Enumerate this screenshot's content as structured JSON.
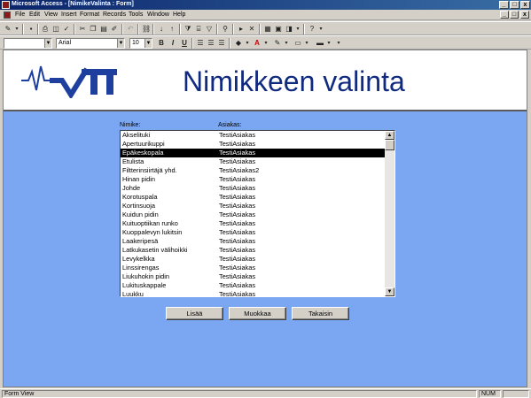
{
  "window": {
    "title": "Microsoft Access - [NimikeValinta : Form]",
    "min": "_",
    "max": "□",
    "close": "x"
  },
  "menu": [
    "File",
    "Edit",
    "View",
    "Insert",
    "Format",
    "Records",
    "Tools",
    "Window",
    "Help"
  ],
  "mdi": {
    "min": "_",
    "max": "□",
    "close": "x"
  },
  "toolbar_format": {
    "object_combo": "",
    "font_combo": "Arial",
    "size_combo": "10",
    "bold": "B",
    "italic": "I",
    "underline": "U"
  },
  "form": {
    "title": "Nimikkeen valinta",
    "col_headers": [
      "Nimike:",
      "Asiakas:"
    ],
    "rows": [
      [
        "Akselituki",
        "TestiAsiakas"
      ],
      [
        "Apertuurikuppi",
        "TestiAsiakas"
      ],
      [
        "Epäkeskopala",
        "TestiAsiakas"
      ],
      [
        "Etulista",
        "TestiAsiakas"
      ],
      [
        "Filtterinsiirtäjä yhd.",
        "TestiAsiakas2"
      ],
      [
        "Hinan pidin",
        "TestiAsiakas"
      ],
      [
        "Johde",
        "TestiAsiakas"
      ],
      [
        "Korotuspala",
        "TestiAsiakas"
      ],
      [
        "Kortinsuoja",
        "TestiAsiakas"
      ],
      [
        "Kuidun pidin",
        "TestiAsiakas"
      ],
      [
        "Kuituoptiikan runko",
        "TestiAsiakas"
      ],
      [
        "Kuoppalevyn lukitsin",
        "TestiAsiakas"
      ],
      [
        "Laakeripesä",
        "TestiAsiakas"
      ],
      [
        "Latkukasetin välihoikki",
        "TestiAsiakas"
      ],
      [
        "Levykelkka",
        "TestiAsiakas"
      ],
      [
        "Linssirengas",
        "TestiAsiakas"
      ],
      [
        "Liukuhokin pidin",
        "TestiAsiakas"
      ],
      [
        "Lukituskappale",
        "TestiAsiakas"
      ],
      [
        "Luukku",
        "TestiAsiakas"
      ]
    ],
    "selected_row": 2,
    "buttons": {
      "add": "Lisää",
      "edit": "Muokkaa",
      "back": "Takaisin"
    }
  },
  "status": {
    "left": "Form View",
    "num": "NUM"
  },
  "colors": {
    "title": "#102a80",
    "form_bg": "#7ba7f2",
    "logo": "#1f3f9f"
  }
}
